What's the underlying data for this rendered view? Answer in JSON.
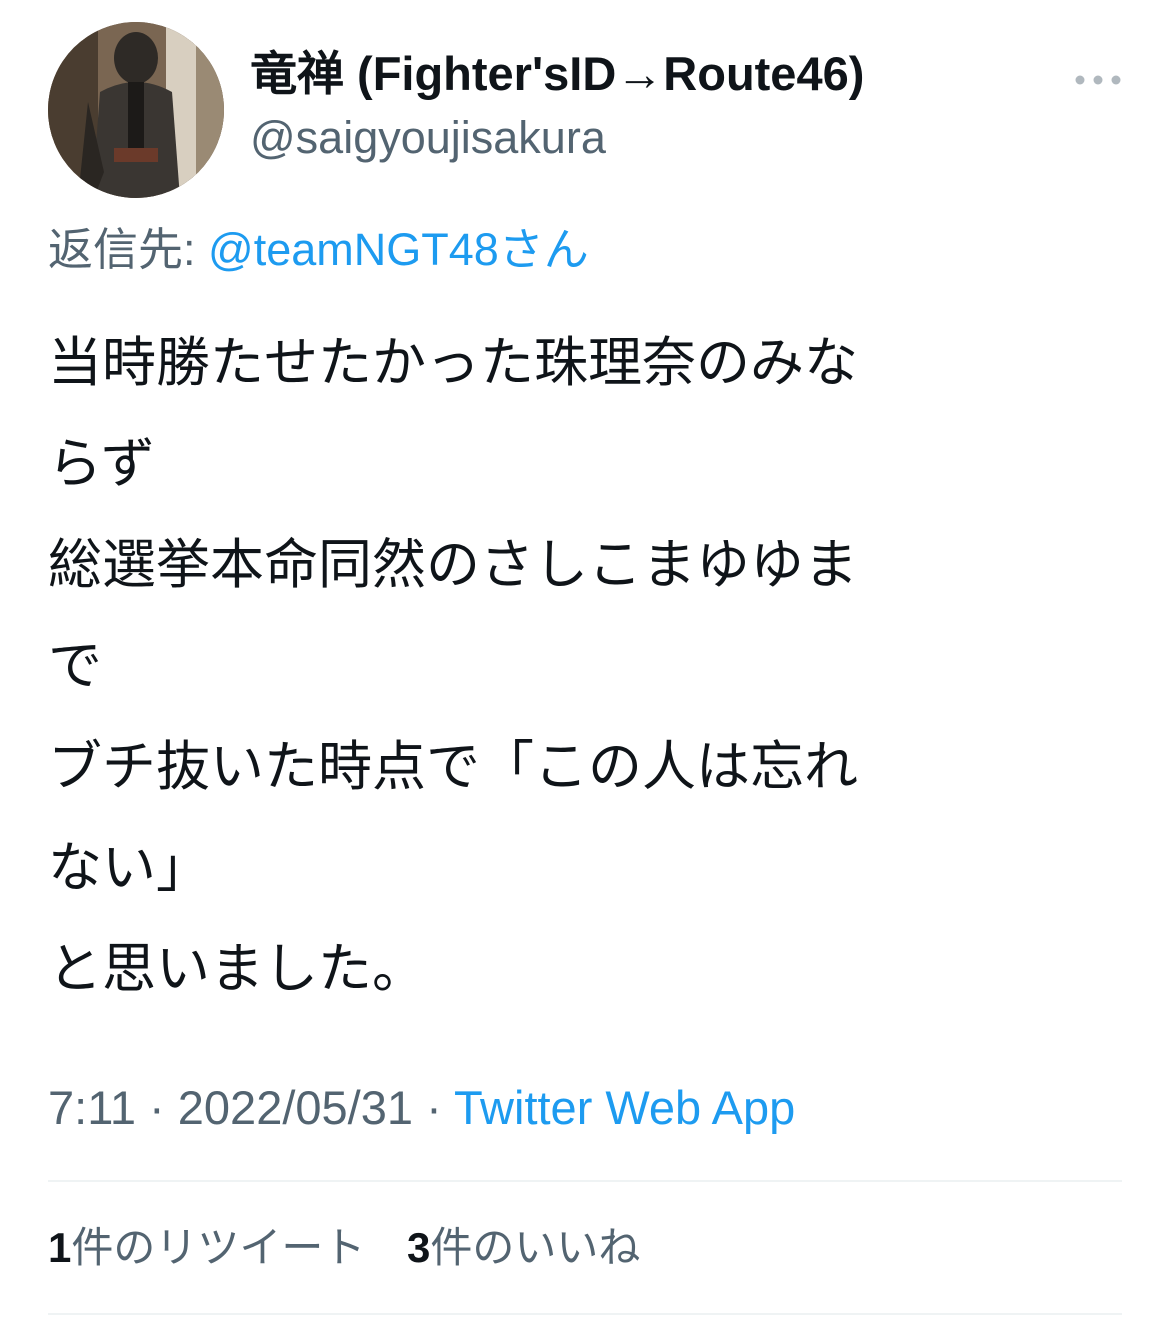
{
  "user": {
    "display_name": "竜禅 (Fighter'sID→Route46)",
    "handle": "@saigyoujisakura"
  },
  "reply": {
    "prefix": "返信先:",
    "mention": "@teamNGT48さん"
  },
  "tweet": {
    "lines": [
      "当時勝たせたかった珠理奈のみな",
      "らず",
      "総選挙本命同然のさしこまゆゆま",
      "で",
      "ブチ抜いた時点で「この人は忘れ",
      "ない」",
      "と思いました。"
    ]
  },
  "meta": {
    "time": "7:11",
    "separator1": " · ",
    "date": "2022/05/31",
    "separator2": " · ",
    "source": "Twitter Web App"
  },
  "stats": {
    "retweets": {
      "count": "1",
      "label": "件のリツイート"
    },
    "likes": {
      "count": "3",
      "label": "件のいいね"
    }
  },
  "icons": {
    "more": "more-horizontal-icon"
  },
  "colors": {
    "text": "#0f1419",
    "secondary": "#536471",
    "link": "#1d9bf0",
    "divider": "#eff3f4"
  }
}
